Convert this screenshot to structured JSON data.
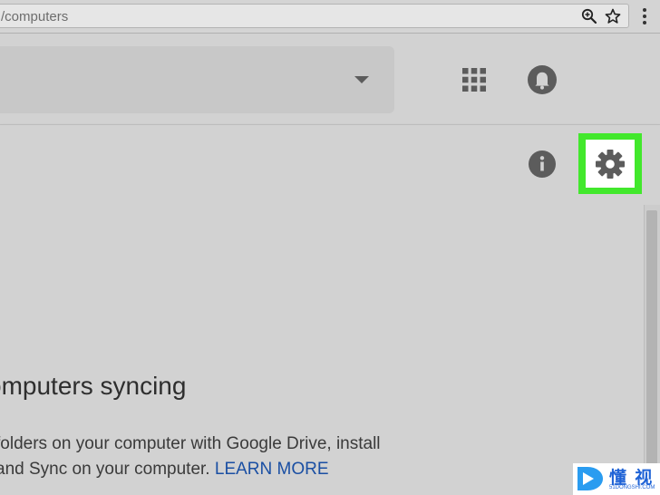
{
  "browser": {
    "url": "/computers",
    "menu_icon": "vertical-dots-icon",
    "zoom_icon": "magnifier-plus-icon",
    "bookmark_icon": "star-outline-icon"
  },
  "header": {
    "apps_icon": "grid-apps-icon",
    "notifications_icon": "bell-icon",
    "search_dropdown_icon": "caret-down-icon"
  },
  "toolbar": {
    "info_icon": "info-icon",
    "settings_icon": "gear-icon",
    "highlight_color": "#42e82c"
  },
  "main": {
    "heading": "omputers syncing",
    "description_line1": "folders on your computer with Google Drive, install",
    "description_line2": " and Sync on your computer. ",
    "learn_more": "LEARN MORE"
  },
  "watermark": {
    "chars": "懂 视",
    "sub": "51DONGSHI.COM"
  },
  "colors": {
    "background": "#d2d2d2",
    "link": "#1a4fa3",
    "icon": "#5c5c5c"
  }
}
